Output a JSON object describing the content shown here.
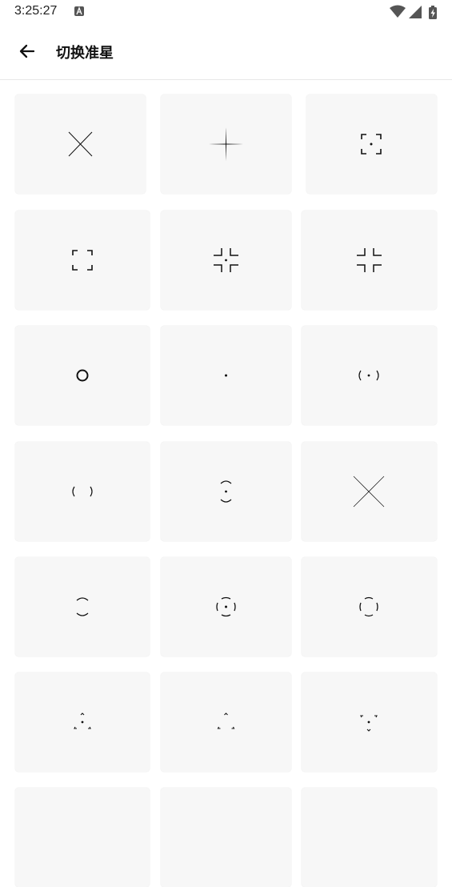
{
  "status_bar": {
    "time": "3:25:27",
    "icons": [
      "notification-a-icon",
      "wifi-icon",
      "cellular-signal-icon",
      "battery-charging-icon"
    ]
  },
  "app_bar": {
    "back_icon": "arrow-back-icon",
    "title": "切换准星"
  },
  "crosshair_options": [
    {
      "icon": "x-crosshair-icon"
    },
    {
      "icon": "plus-crosshair-icon"
    },
    {
      "icon": "corners-dot-crosshair-icon"
    },
    {
      "icon": "corners-crosshair-icon"
    },
    {
      "icon": "inner-corners-dot-crosshair-icon"
    },
    {
      "icon": "inner-corners-crosshair-icon"
    },
    {
      "icon": "circle-crosshair-icon"
    },
    {
      "icon": "dot-crosshair-icon"
    },
    {
      "icon": "parens-dot-crosshair-icon"
    },
    {
      "icon": "parens-crosshair-icon"
    },
    {
      "icon": "arcs-vertical-dot-crosshair-icon"
    },
    {
      "icon": "large-x-crosshair-icon"
    },
    {
      "icon": "arcs-vertical-crosshair-icon"
    },
    {
      "icon": "circle-dot-crosshair-icon"
    },
    {
      "icon": "circle-split-crosshair-icon"
    },
    {
      "icon": "triangle-dot-crosshair-icon"
    },
    {
      "icon": "triangle-crosshair-icon"
    },
    {
      "icon": "inverted-triangle-dot-crosshair-icon"
    },
    {
      "icon": "crosshair-partial-icon"
    },
    {
      "icon": "crosshair-partial-icon"
    },
    {
      "icon": "crosshair-partial-icon"
    }
  ]
}
